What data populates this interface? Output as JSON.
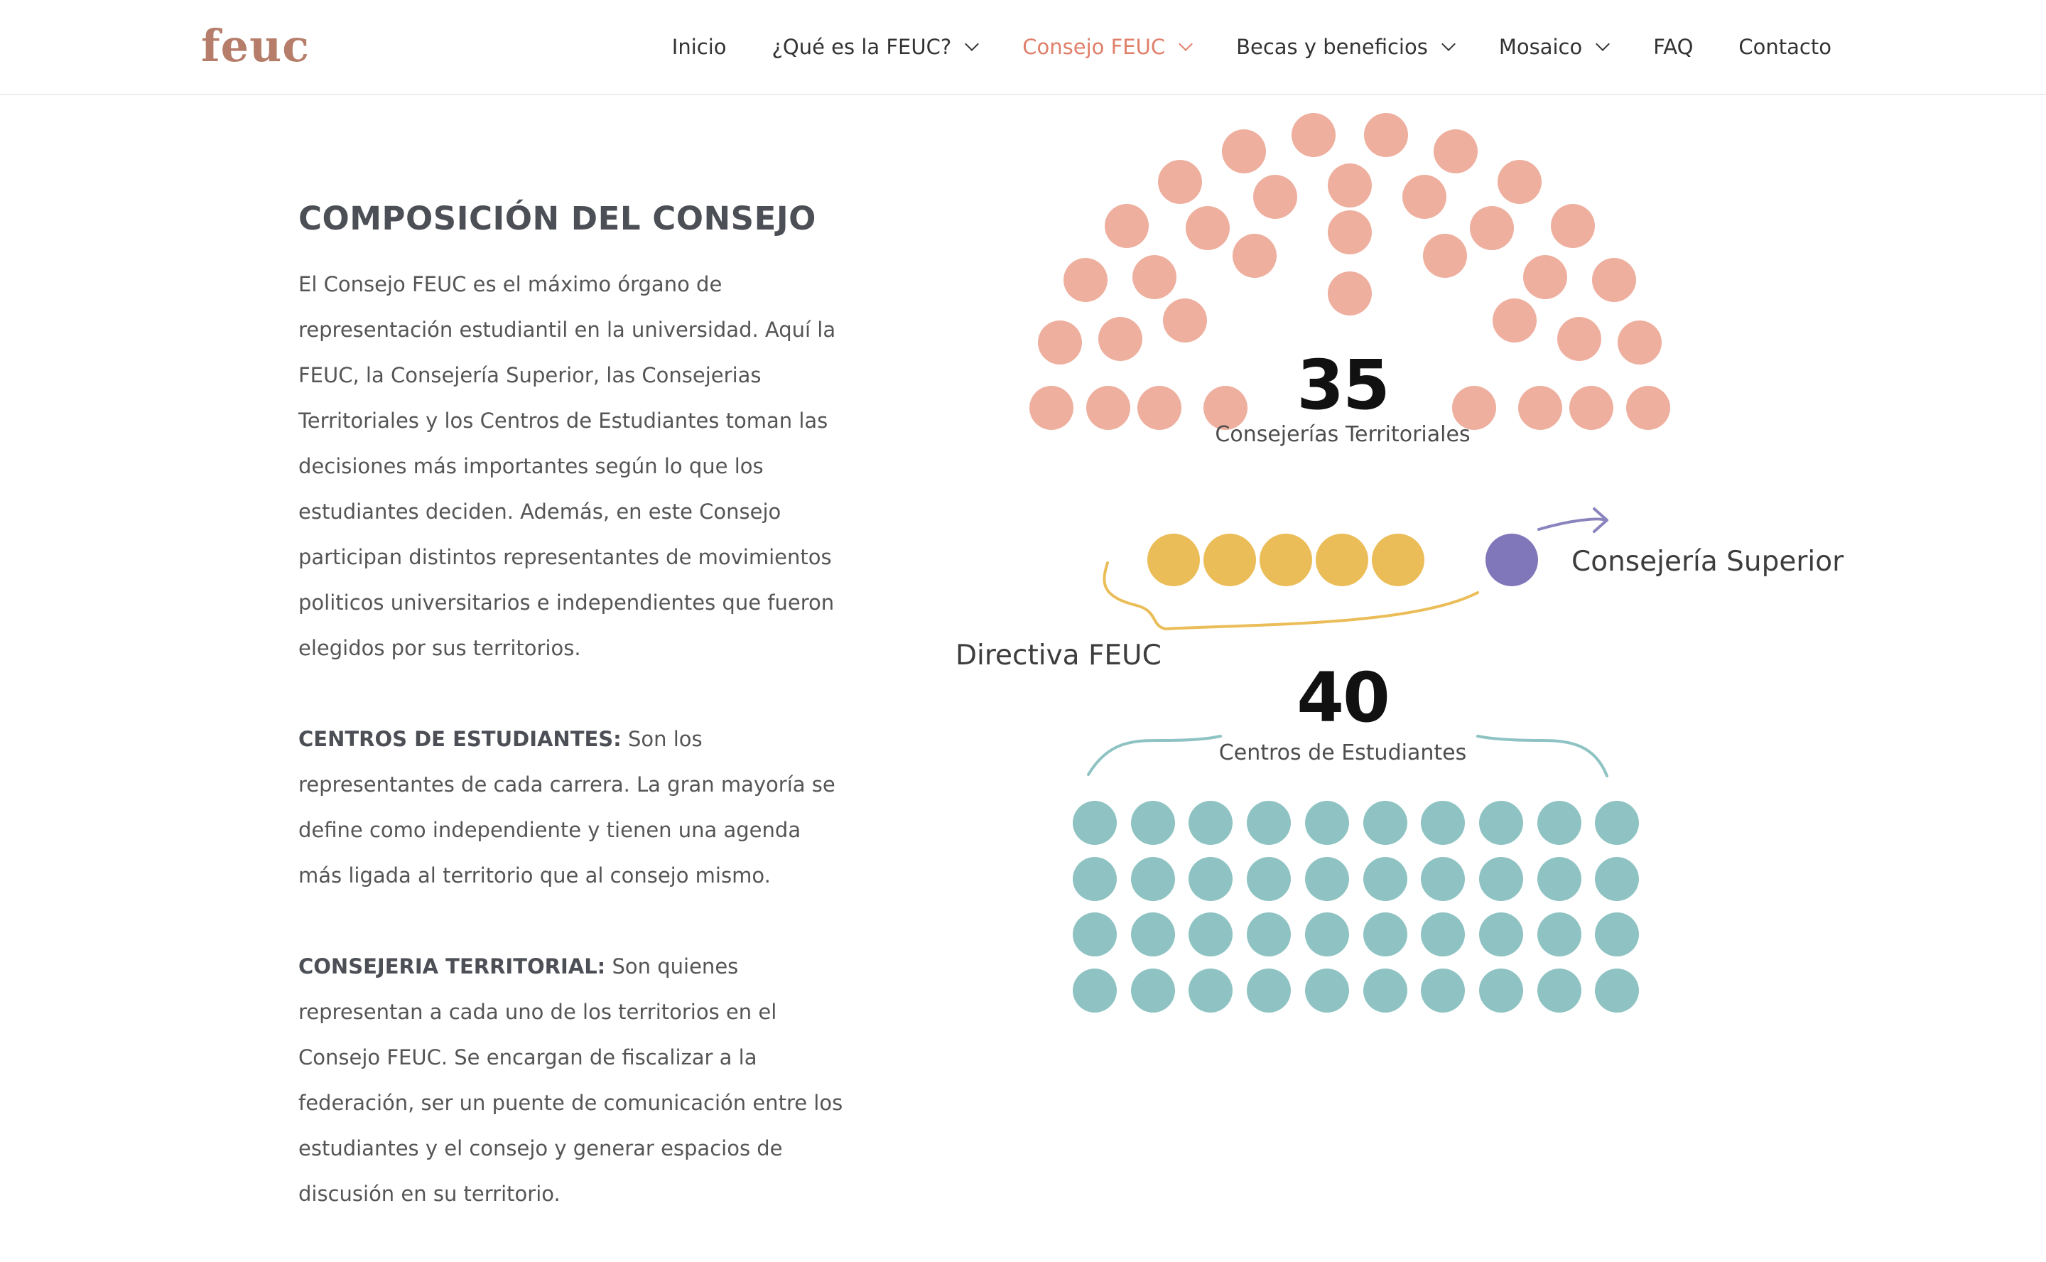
{
  "header": {
    "logo": "feuc",
    "nav": [
      {
        "label": "Inicio",
        "dropdown": false,
        "active": false
      },
      {
        "label": "¿Qué es la FEUC?",
        "dropdown": true,
        "active": false
      },
      {
        "label": "Consejo FEUC",
        "dropdown": true,
        "active": true
      },
      {
        "label": "Becas y beneficios",
        "dropdown": true,
        "active": false
      },
      {
        "label": "Mosaico",
        "dropdown": true,
        "active": false
      },
      {
        "label": "FAQ",
        "dropdown": false,
        "active": false
      },
      {
        "label": "Contacto",
        "dropdown": false,
        "active": false
      }
    ]
  },
  "content": {
    "title": "COMPOSICIÓN DEL CONSEJO",
    "intro": "El Consejo FEUC es el máximo órgano de representación estudiantil en la universidad. Aquí la FEUC, la Consejería Superior, las Consejerias Territoriales y los Centros de Estudiantes toman las decisiones más importantes según lo que los estudiantes deciden. Además, en este Consejo participan distintos representantes de movimientos politicos universitarios e independientes que fueron elegidos por sus territorios.",
    "centros_heading": "CENTROS DE ESTUDIANTES:",
    "centros_text": " Son los representantes de cada carrera. La gran mayoría se define como independiente y tienen una agenda más ligada al territorio que al consejo mismo.",
    "territorial_heading": "CONSEJERIA TERRITORIAL:",
    "territorial_text": " Son quienes representan a cada uno de los territorios en el Consejo FEUC. Se encargan de fiscalizar a la federación, ser un puente de comunicación entre los estudiantes y el consejo y generar espacios de discusión en su territorio."
  },
  "infographic": {
    "territoriales": {
      "count": 35,
      "number": "35",
      "label": "Consejerías Territoriales",
      "color": "#eeaf9e"
    },
    "directiva": {
      "count": 5,
      "label": "Directiva FEUC",
      "color": "#ebbd58"
    },
    "superior": {
      "count": 1,
      "label": "Consejería Superior",
      "color": "#7f77b9"
    },
    "centros": {
      "count": 40,
      "number": "40",
      "label": "Centros de  Estudiantes",
      "color": "#8fc3c3"
    }
  }
}
